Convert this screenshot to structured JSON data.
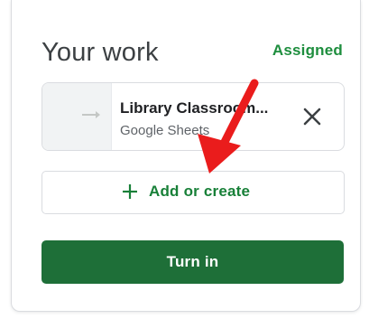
{
  "your_work": {
    "title": "Your work",
    "status": "Assigned"
  },
  "attachment": {
    "name": "Library Classroom...",
    "type": "Google Sheets",
    "remove_icon": "close-icon"
  },
  "actions": {
    "add_label": "Add or create",
    "add_icon": "plus-icon",
    "turn_in_label": "Turn in"
  },
  "colors": {
    "status_green": "#1e8e3e",
    "button_green": "#1e6f38",
    "add_text_green": "#188038",
    "annotation_red": "#ea1c1c"
  }
}
